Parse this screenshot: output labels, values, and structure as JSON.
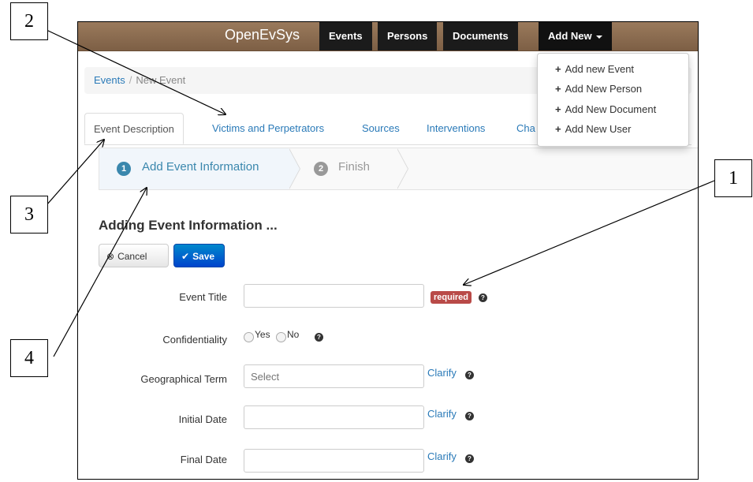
{
  "navbar": {
    "brand": "OpenEvSys",
    "items": [
      "Events",
      "Persons",
      "Documents",
      "Add New"
    ]
  },
  "dropdown": {
    "items": [
      "Add new Event",
      "Add New Person",
      "Add New Document",
      "Add New User"
    ]
  },
  "breadcrumb": {
    "root": "Events",
    "separator": "/",
    "current": "New Event"
  },
  "tabs": [
    "Event Description",
    "Victims and Perpetrators",
    "Sources",
    "Interventions",
    "Cha"
  ],
  "wizard": {
    "steps": [
      {
        "number": "1",
        "label": "Add Event Information"
      },
      {
        "number": "2",
        "label": "Finish"
      }
    ]
  },
  "form": {
    "heading": "Adding Event Information ...",
    "cancel_label": "Cancel",
    "save_label": "Save",
    "fields": {
      "title_label": "Event Title",
      "required_badge": "required",
      "confidentiality_label": "Confidentiality",
      "yes": "Yes",
      "no": "No",
      "geo_label": "Geographical Term",
      "geo_placeholder": "Select",
      "initial_date_label": "Initial Date",
      "final_date_label": "Final Date",
      "clarify": "Clarify"
    }
  },
  "callouts": [
    "1",
    "2",
    "3",
    "4"
  ],
  "colors": {
    "navbar": "#8b6b4f",
    "link": "#2a7ab8",
    "required": "#b94a48",
    "save": "#0066cc"
  }
}
